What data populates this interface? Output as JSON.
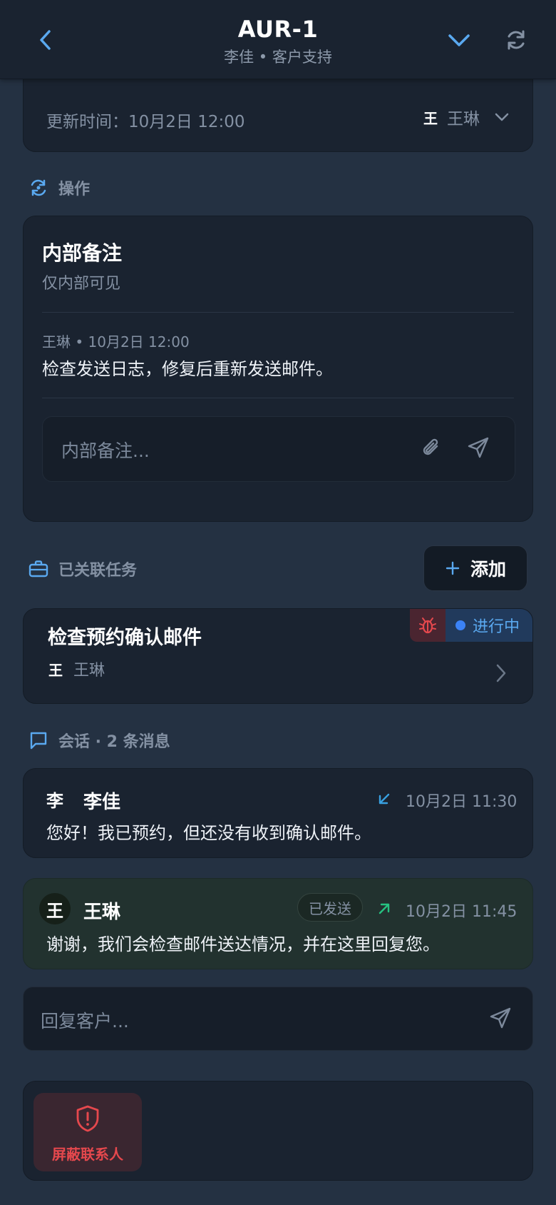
{
  "header": {
    "title": "AUR-1",
    "subtitle": "李佳 • 客户支持"
  },
  "details": {
    "updated_label": "更新时间：10月2日 12:00",
    "assignee_avatar": "王",
    "assignee": "王琳"
  },
  "actions": {
    "section_title": "操作",
    "note_card": {
      "title": "内部备注",
      "subtitle": "仅内部可见",
      "note_meta": "王琳 • 10月2日 12:00",
      "note_text": "检查发送日志，修复后重新发送邮件。",
      "input_placeholder": "内部备注..."
    }
  },
  "linked_tasks": {
    "section_title": "已关联任务",
    "add_button": "添加",
    "task": {
      "title": "检查预约确认邮件",
      "assignee_avatar": "王",
      "assignee": "王琳",
      "status": "进行中",
      "status_color": "#3b82f6",
      "type_icon": "bug-icon"
    }
  },
  "conversation": {
    "section_title": "会话 · 2 条消息",
    "messages": [
      {
        "avatar": "李",
        "sender": "李佳",
        "direction_icon": "arrow-down-left-icon",
        "time": "10月2日 11:30",
        "text": "您好！我已预约，但还没有收到确认邮件。"
      },
      {
        "avatar": "王",
        "sender": "王琳",
        "badge": "已发送",
        "direction_icon": "arrow-up-right-icon",
        "time": "10月2日 11:45",
        "text": "谢谢，我们会检查邮件送达情况，并在这里回复您。"
      }
    ],
    "reply_placeholder": "回复客户..."
  },
  "danger": {
    "block_contact": "屏蔽联系人",
    "block_icon": "shield-alert-icon"
  },
  "colors": {
    "accent": "#5aa9f0",
    "danger": "#e5484d",
    "incoming_arrow": "#38a0e0",
    "outgoing_arrow": "#26c281"
  }
}
